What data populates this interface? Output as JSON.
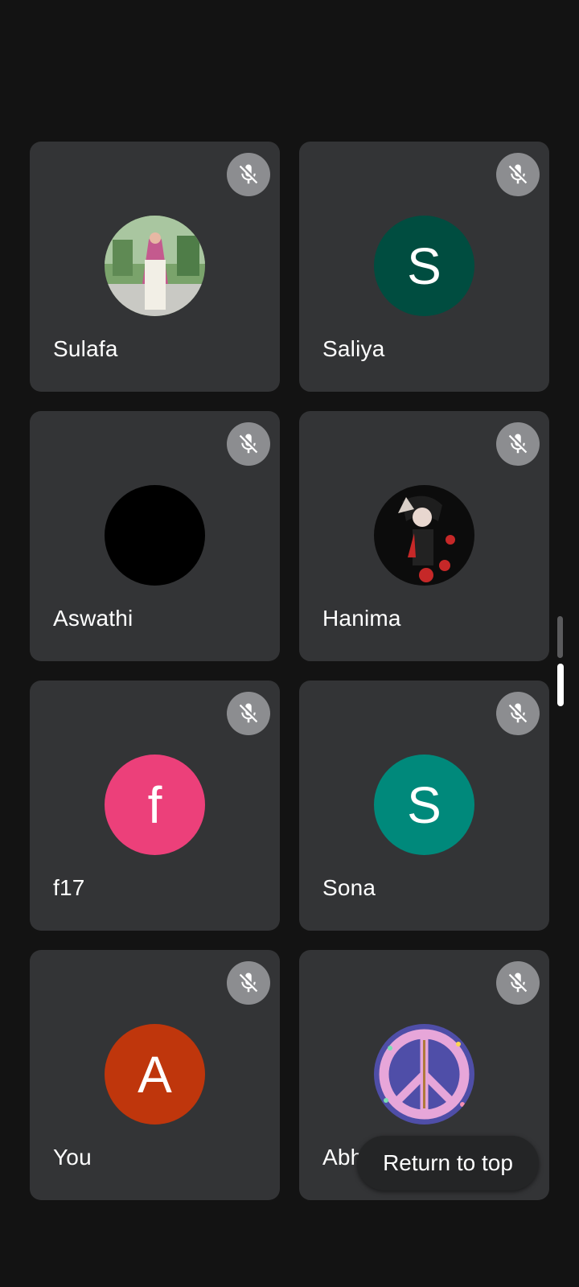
{
  "participants": [
    {
      "name": "Sulafa",
      "avatar_type": "photo",
      "avatar_desc": "woman-in-pink-scarf-photo",
      "muted": true
    },
    {
      "name": "Saliya",
      "avatar_type": "initial",
      "initial": "S",
      "color": "#004d40",
      "muted": true
    },
    {
      "name": "Aswathi",
      "avatar_type": "photo",
      "avatar_desc": "black-image",
      "color": "#000000",
      "muted": true
    },
    {
      "name": "Hanima",
      "avatar_type": "photo",
      "avatar_desc": "anime-character-photo",
      "muted": true
    },
    {
      "name": "f17",
      "avatar_type": "initial",
      "initial": "f",
      "color": "#ec407a",
      "muted": true
    },
    {
      "name": "Sona",
      "avatar_type": "initial",
      "initial": "S",
      "color": "#00897b",
      "muted": true
    },
    {
      "name": "You",
      "avatar_type": "initial",
      "initial": "A",
      "color": "#bf360c",
      "muted": true
    },
    {
      "name": "Abhi",
      "avatar_type": "photo",
      "avatar_desc": "peace-sign-image",
      "muted": true
    }
  ],
  "return_to_top": {
    "label": "Return to top"
  },
  "icons": {
    "mute": "mic-off-icon"
  }
}
